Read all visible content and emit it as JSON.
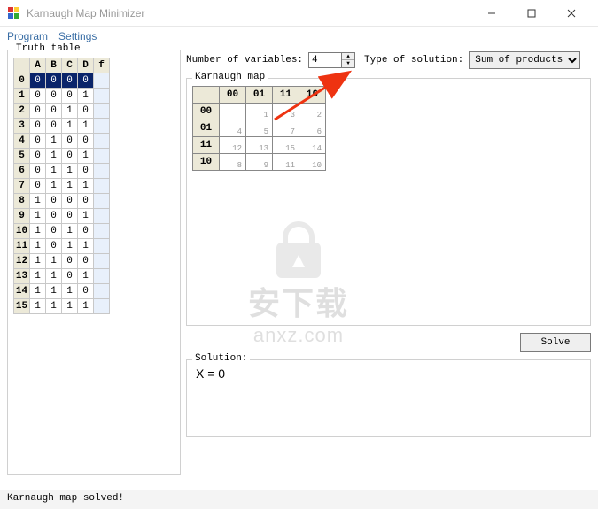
{
  "window": {
    "title": "Karnaugh Map Minimizer"
  },
  "menu": {
    "program": "Program",
    "settings": "Settings"
  },
  "truth": {
    "legend": "Truth table",
    "headers": [
      "",
      "A",
      "B",
      "C",
      "D",
      "f"
    ],
    "rows": [
      {
        "i": "0",
        "v": [
          "0",
          "0",
          "0",
          "0",
          ""
        ]
      },
      {
        "i": "1",
        "v": [
          "0",
          "0",
          "0",
          "1",
          ""
        ]
      },
      {
        "i": "2",
        "v": [
          "0",
          "0",
          "1",
          "0",
          ""
        ]
      },
      {
        "i": "3",
        "v": [
          "0",
          "0",
          "1",
          "1",
          ""
        ]
      },
      {
        "i": "4",
        "v": [
          "0",
          "1",
          "0",
          "0",
          ""
        ]
      },
      {
        "i": "5",
        "v": [
          "0",
          "1",
          "0",
          "1",
          ""
        ]
      },
      {
        "i": "6",
        "v": [
          "0",
          "1",
          "1",
          "0",
          ""
        ]
      },
      {
        "i": "7",
        "v": [
          "0",
          "1",
          "1",
          "1",
          ""
        ]
      },
      {
        "i": "8",
        "v": [
          "1",
          "0",
          "0",
          "0",
          ""
        ]
      },
      {
        "i": "9",
        "v": [
          "1",
          "0",
          "0",
          "1",
          ""
        ]
      },
      {
        "i": "10",
        "v": [
          "1",
          "0",
          "1",
          "0",
          ""
        ]
      },
      {
        "i": "11",
        "v": [
          "1",
          "0",
          "1",
          "1",
          ""
        ]
      },
      {
        "i": "12",
        "v": [
          "1",
          "1",
          "0",
          "0",
          ""
        ]
      },
      {
        "i": "13",
        "v": [
          "1",
          "1",
          "0",
          "1",
          ""
        ]
      },
      {
        "i": "14",
        "v": [
          "1",
          "1",
          "1",
          "0",
          ""
        ]
      },
      {
        "i": "15",
        "v": [
          "1",
          "1",
          "1",
          "1",
          ""
        ]
      }
    ],
    "selected_row": 0
  },
  "controls": {
    "numvars_label": "Number of variables:",
    "numvars_value": "4",
    "soltype_label": "Type of solution:",
    "soltype_value": "Sum of products"
  },
  "kmap": {
    "legend": "Karnaugh map",
    "col_headers": [
      "00",
      "01",
      "11",
      "10"
    ],
    "row_headers": [
      "00",
      "01",
      "11",
      "10"
    ],
    "cells": [
      [
        "",
        "1",
        "3",
        "2"
      ],
      [
        "4",
        "5",
        "7",
        "6"
      ],
      [
        "12",
        "13",
        "15",
        "14"
      ],
      [
        "8",
        "9",
        "11",
        "10"
      ]
    ]
  },
  "solve_label": "Solve",
  "solution": {
    "legend": "Solution:",
    "text": "X = 0"
  },
  "status": "Karnaugh map solved!",
  "watermark": {
    "cn": "安下载",
    "en": "anxz.com"
  }
}
